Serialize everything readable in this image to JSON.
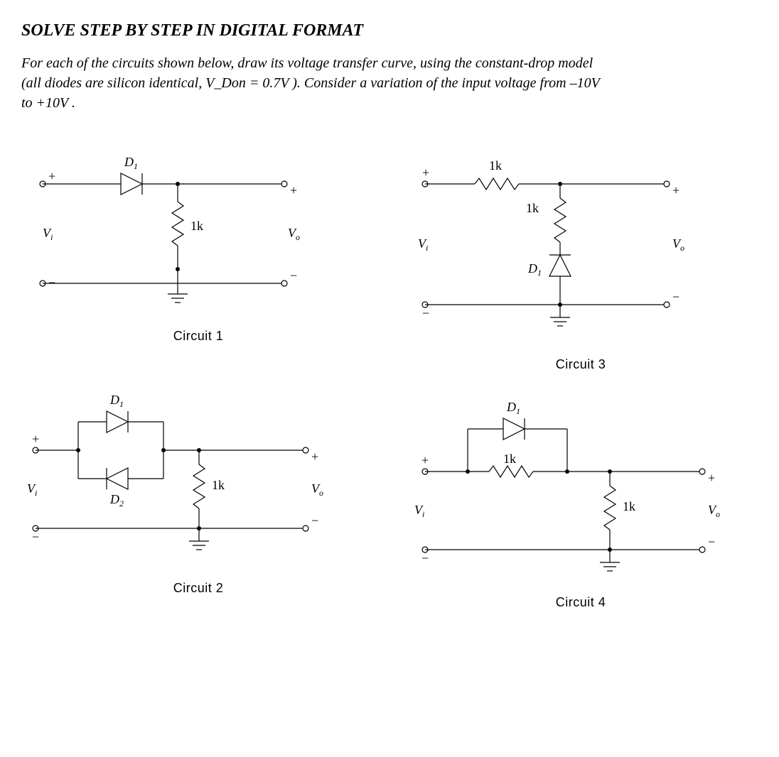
{
  "title": "SOLVE STEP BY STEP IN DIGITAL FORMAT",
  "problem": "For each of the circuits shown below, draw its voltage transfer curve, using the constant-drop model (all diodes are silicon identical, V_Don = 0.7V ). Consider a variation of the input voltage from –10V to +10V .",
  "common": {
    "vi": "V",
    "vi_sub": "i",
    "vo": "V",
    "vo_sub": "o",
    "plus": "+",
    "minus": "−",
    "r1k": "1k"
  },
  "circuits": [
    {
      "caption": "Circuit  1",
      "components": {
        "D1": "D",
        "D1_sub": "1"
      }
    },
    {
      "caption": "Circuit  2",
      "components": {
        "D1": "D",
        "D1_sub": "1",
        "D2": "D",
        "D2_sub": "2"
      }
    },
    {
      "caption": "Circuit  3",
      "components": {
        "D1": "D",
        "D1_sub": "1"
      }
    },
    {
      "caption": "Circuit  4",
      "components": {
        "D1": "D",
        "D1_sub": "1"
      }
    }
  ]
}
